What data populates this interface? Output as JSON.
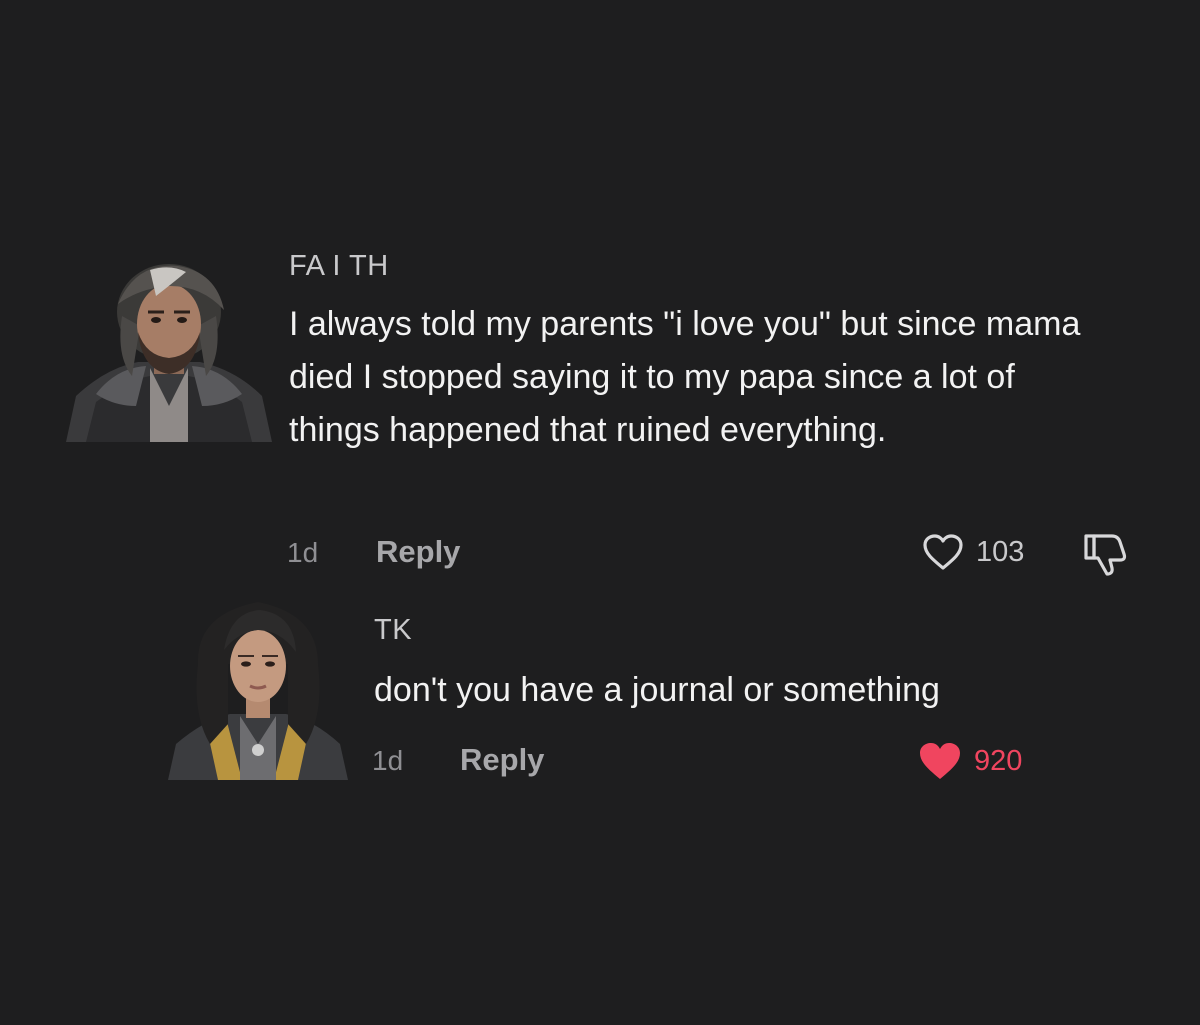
{
  "comments": [
    {
      "username": "FA I TH",
      "text": "I always told my parents \"i love you\" but since mama died I stopped saying it to my papa since a lot of things happened that ruined everything.",
      "time": "1d",
      "reply_label": "Reply",
      "likes": "103",
      "liked": false
    },
    {
      "username": "TK",
      "text": "don't you have a journal or something",
      "time": "1d",
      "reply_label": "Reply",
      "likes": "920",
      "liked": true
    }
  ],
  "colors": {
    "background": "#1e1e1f",
    "liked_heart": "#f0455f"
  },
  "icons": [
    "heart-outline-icon",
    "heart-filled-icon",
    "thumbs-down-icon"
  ]
}
